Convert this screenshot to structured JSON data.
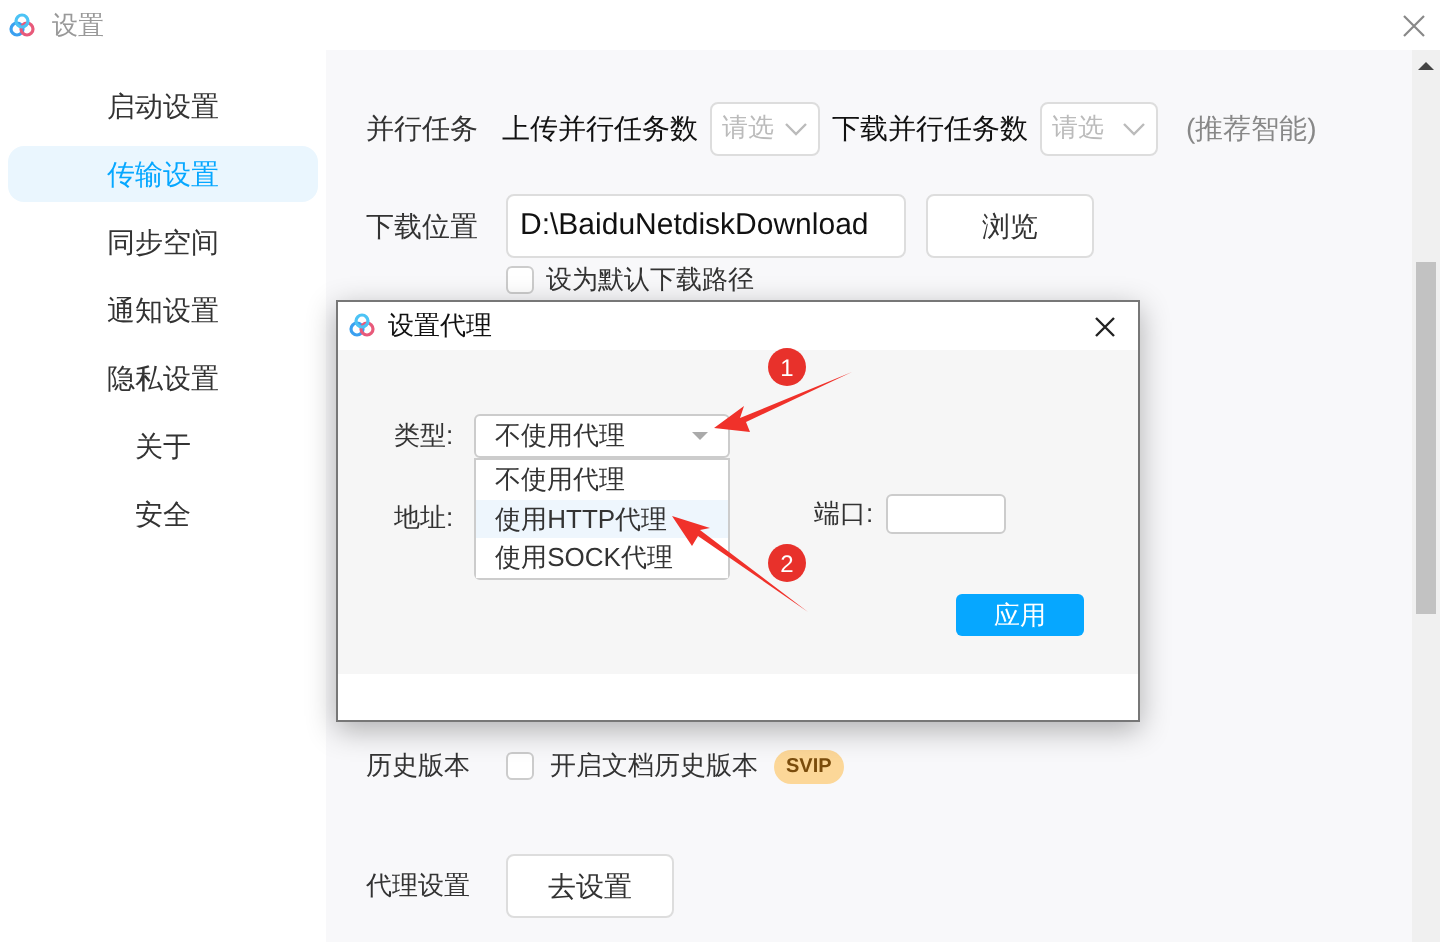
{
  "window": {
    "title": "设置"
  },
  "sidebar": {
    "items": [
      {
        "label": "启动设置",
        "selected": false
      },
      {
        "label": "传输设置",
        "selected": true
      },
      {
        "label": "同步空间",
        "selected": false
      },
      {
        "label": "通知设置",
        "selected": false
      },
      {
        "label": "隐私设置",
        "selected": false
      },
      {
        "label": "关于",
        "selected": false
      },
      {
        "label": "安全",
        "selected": false
      }
    ]
  },
  "parallel": {
    "label": "并行任务",
    "upload_label": "上传并行任务数",
    "upload_placeholder": "请选",
    "download_label": "下载并行任务数",
    "download_placeholder": "请选",
    "hint": "(推荐智能)"
  },
  "download": {
    "label": "下载位置",
    "path": "D:\\BaiduNetdiskDownload",
    "browse": "浏览",
    "default_checkbox": {
      "label": "设为默认下载路径",
      "checked": false
    }
  },
  "history": {
    "label": "历史版本",
    "checkbox": {
      "label": "开启文档历史版本",
      "checked": false
    },
    "badge": "SVIP"
  },
  "proxy": {
    "label": "代理设置",
    "button": "去设置"
  },
  "dialog": {
    "title": "设置代理",
    "type_label": "类型:",
    "type_value": "不使用代理",
    "options": [
      {
        "label": "不使用代理",
        "selected": false
      },
      {
        "label": "使用HTTP代理",
        "selected": true
      },
      {
        "label": "使用SOCK代理",
        "selected": false
      }
    ],
    "address_label": "地址:",
    "port_label": "端口:",
    "apply": "应用"
  },
  "annotations": [
    {
      "number": "1"
    },
    {
      "number": "2"
    }
  ]
}
